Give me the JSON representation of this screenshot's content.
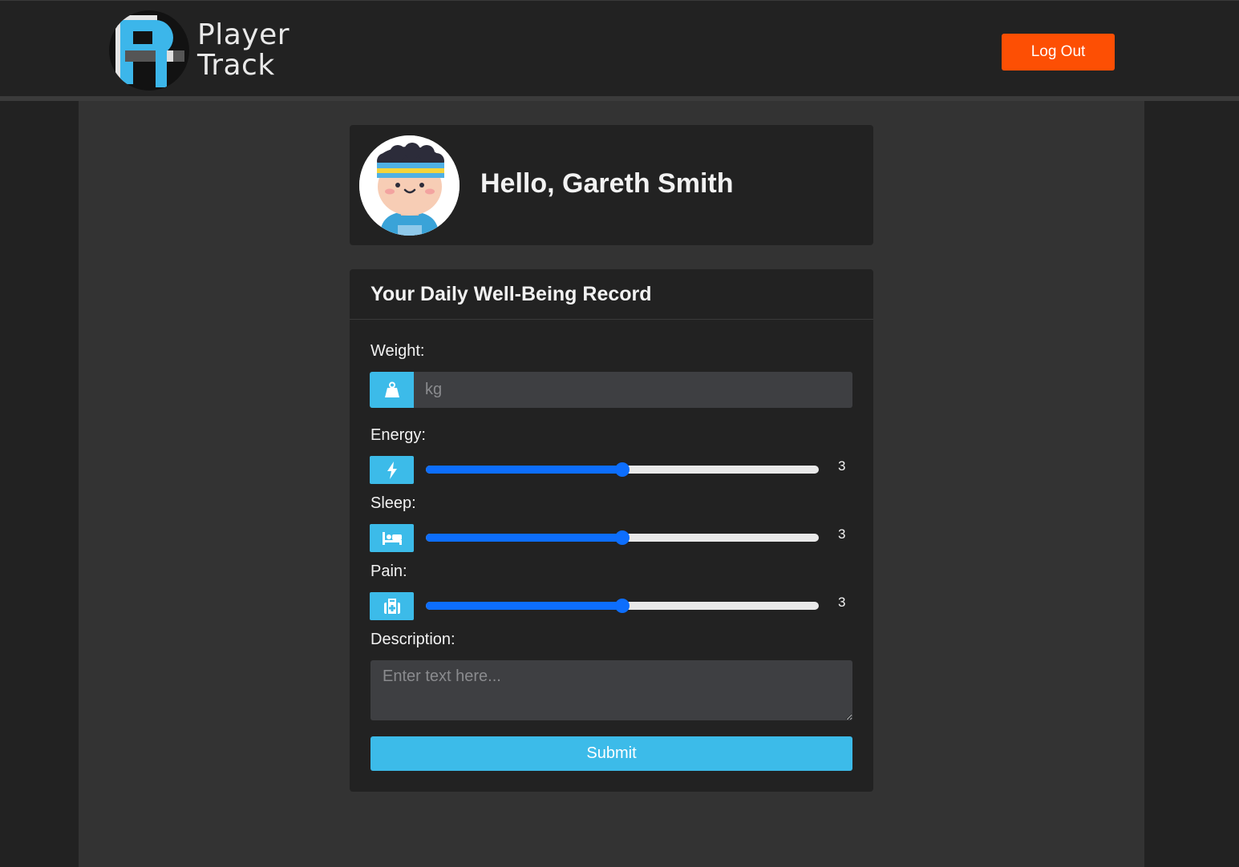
{
  "header": {
    "logo_line1": "Player",
    "logo_line2": "Track",
    "logout_label": "Log Out"
  },
  "profile": {
    "greeting": "Hello, Gareth Smith",
    "avatar_icon": "athlete-avatar-icon"
  },
  "form": {
    "title": "Your Daily Well-Being Record",
    "weight": {
      "label": "Weight:",
      "placeholder": "kg",
      "icon": "weight-icon"
    },
    "energy": {
      "label": "Energy:",
      "value": "3",
      "min": 1,
      "max": 5,
      "icon": "lightning-icon"
    },
    "sleep": {
      "label": "Sleep:",
      "value": "3",
      "min": 1,
      "max": 5,
      "icon": "bed-icon"
    },
    "pain": {
      "label": "Pain:",
      "value": "3",
      "min": 1,
      "max": 5,
      "icon": "medical-kit-icon"
    },
    "description": {
      "label": "Description:",
      "placeholder": "Enter text here..."
    },
    "submit_label": "Submit"
  },
  "colors": {
    "accent": "#3cbbe9",
    "logout": "#fd4f04",
    "slider": "#0d6efd",
    "background": "#222222",
    "page": "#333333"
  }
}
